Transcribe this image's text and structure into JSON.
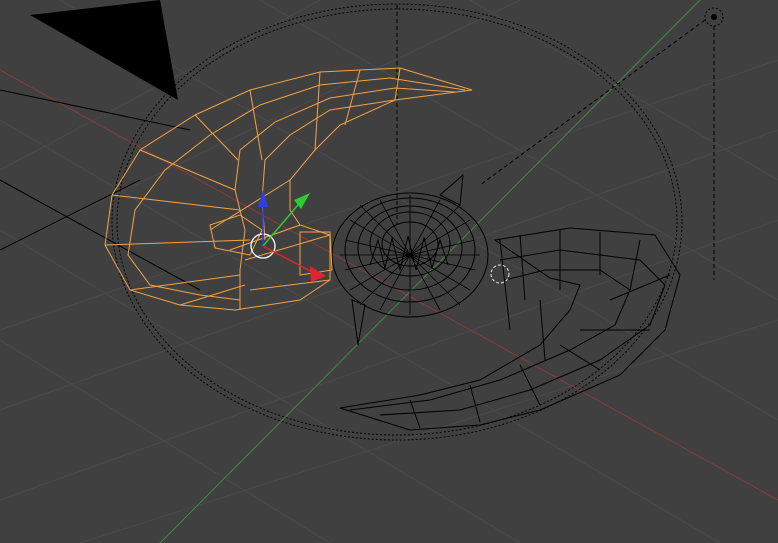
{
  "viewport": {
    "background_color": "#404040",
    "grid_color": "#4a4a4a",
    "x_axis_color": "#8a3a3a",
    "y_axis_color": "#3f8a3f",
    "wire_color": "#000000",
    "selection_color": "#f5a142"
  },
  "gizmo": {
    "x_color": "#e0232f",
    "y_color": "#2ecc2e",
    "z_color": "#2f3fe0"
  },
  "objects": [
    {
      "name": "selected-blade",
      "state": "selected"
    },
    {
      "name": "opposite-blade",
      "state": "unselected"
    },
    {
      "name": "center-hub",
      "state": "unselected"
    }
  ]
}
